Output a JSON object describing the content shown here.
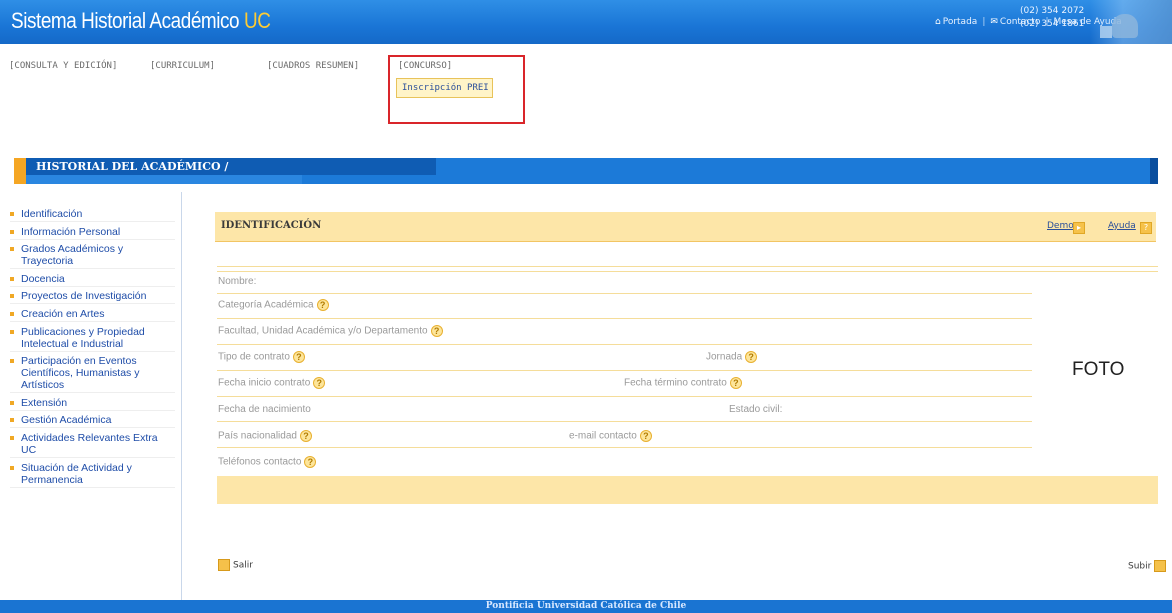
{
  "header": {
    "title_main": "Sistema Historial Académico ",
    "title_accent": "UC",
    "links": [
      "Portada",
      "Contacto",
      "Mesa de Ayuda"
    ],
    "phones": [
      "(02) 354 2072",
      "(02) 354 1861"
    ]
  },
  "menu": {
    "items": [
      "[CONSULTA Y EDICIÓN]",
      "[CURRICULUM]",
      "[CUADROS RESUMEN]",
      "[CONCURSO]"
    ],
    "submenu": "Inscripción PREI"
  },
  "section": {
    "title": "HISTORIAL DEL ACADÉMICO /"
  },
  "sidebar": {
    "items": [
      "Identificación",
      "Información Personal",
      "Grados Académicos y Trayectoria",
      "Docencia",
      "Proyectos de Investigación",
      "Creación en Artes",
      "Publicaciones y Propiedad Intelectual e Industrial",
      "Participación en Eventos Científicos, Humanistas y Artísticos",
      "Extensión",
      "Gestión Académica",
      "Actividades Relevantes Extra UC",
      "Situación de Actividad y Permanencia"
    ]
  },
  "panel": {
    "title": "IDENTIFICACIÓN",
    "demo": "Demo",
    "ayuda": "Ayuda",
    "fields": {
      "nombre": "Nombre:",
      "categoria": "Categoría Académica",
      "facultad": "Facultad, Unidad Académica y/o Departamento",
      "tipo_contrato": "Tipo de contrato",
      "jornada": "Jornada",
      "fecha_inicio": "Fecha inicio contrato",
      "fecha_termino": "Fecha término contrato",
      "fecha_nacimiento": "Fecha de nacimiento",
      "estado_civil": "Estado civil:",
      "pais": "País nacionalidad",
      "email": "e-mail contacto",
      "telefonos": "Teléfonos contacto"
    },
    "foto": "FOTO"
  },
  "actions": {
    "salir": "Salir",
    "subir": "Subir"
  },
  "footer": {
    "text": "Pontificia Universidad Católica de Chile"
  },
  "colors": {
    "header_blue": "#1a75d6",
    "accent_orange": "#f5a623",
    "panel_cream": "#fde6a8",
    "highlight_red": "#d9252a",
    "link_blue": "#1f4da8"
  }
}
